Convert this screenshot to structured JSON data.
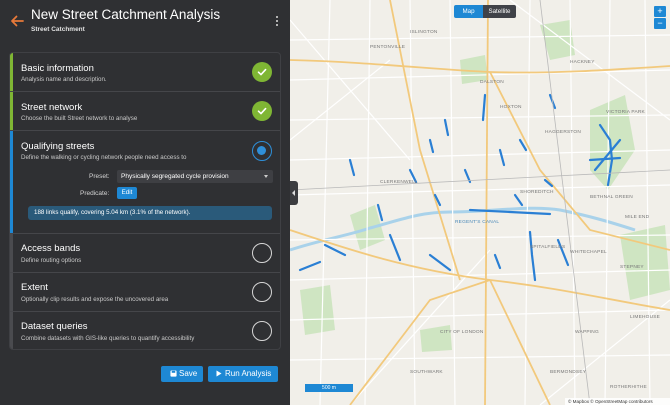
{
  "header": {
    "title": "New Street Catchment Analysis",
    "subtitle": "Street Catchment"
  },
  "steps": [
    {
      "title": "Basic information",
      "desc": "Analysis name and description.",
      "status": "done"
    },
    {
      "title": "Street network",
      "desc": "Choose the built Street network to analyse",
      "status": "done"
    },
    {
      "title": "Qualifying streets",
      "desc": "Define the walking or cycling network people need access to",
      "status": "active"
    },
    {
      "title": "Access bands",
      "desc": "Define routing options",
      "status": "todo"
    },
    {
      "title": "Extent",
      "desc": "Optionally clip results and expose the uncovered area",
      "status": "todo"
    },
    {
      "title": "Dataset queries",
      "desc": "Combine datasets with GIS-like queries to quantify accessibility",
      "status": "todo"
    }
  ],
  "qualifying": {
    "preset_label": "Preset:",
    "preset_value": "Physically segregated cycle provision",
    "predicate_label": "Predicate:",
    "edit_label": "Edit",
    "info": "188 links qualify, covering 5.04 km (3.1% of the network)."
  },
  "actions": {
    "save_label": "Save",
    "run_label": "Run Analysis"
  },
  "map": {
    "toggle_map": "Map",
    "toggle_satellite": "Satellite",
    "zoom_in": "+",
    "zoom_out": "−",
    "scale": "500 m",
    "attribution": "© Mapbox © OpenStreetMap contributors",
    "places": [
      "PENTONVILLE",
      "ISLINGTON",
      "HOXTON",
      "DALSTON",
      "SHOREDITCH",
      "BETHNAL GREEN",
      "CLERKENWELL",
      "HAGGERSTON",
      "SPITALFIELDS",
      "WHITECHAPEL",
      "STEPNEY",
      "MILE END",
      "CITY OF LONDON",
      "SOUTHWARK",
      "BERMONDSEY",
      "WAPPING",
      "LIMEHOUSE",
      "ROTHERHITHE",
      "VICTORIA PARK",
      "REGENT'S CANAL",
      "HACKNEY"
    ],
    "accent": "#2a7fd4"
  }
}
